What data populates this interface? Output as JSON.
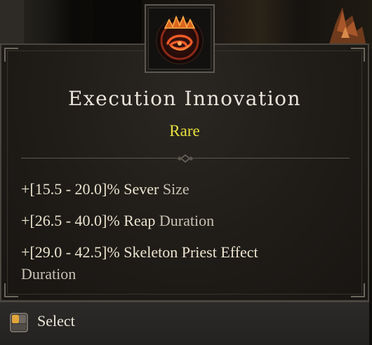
{
  "item": {
    "name": "Execution Innovation",
    "rarity": "Rare",
    "icon": "spiked-ring-aspect-icon"
  },
  "affixes": [
    {
      "value": "+[15.5 - 20.0]%",
      "skill": "Sever",
      "stat": "Size"
    },
    {
      "value": "+[26.5 - 40.0]%",
      "skill": "Reap",
      "stat": "Duration"
    },
    {
      "value": "+[29.0 - 42.5]%",
      "skill": "Skeleton Priest Effect",
      "stat": "Duration"
    }
  ],
  "footer": {
    "icon": "mouse-click-icon",
    "action_label": "Select"
  },
  "colors": {
    "title": "#e9e4da",
    "rarity": "#e6e040",
    "affix_value": "#ece4cf",
    "affix_stat": "#c9c2b4",
    "panel": "#1f1c18"
  }
}
